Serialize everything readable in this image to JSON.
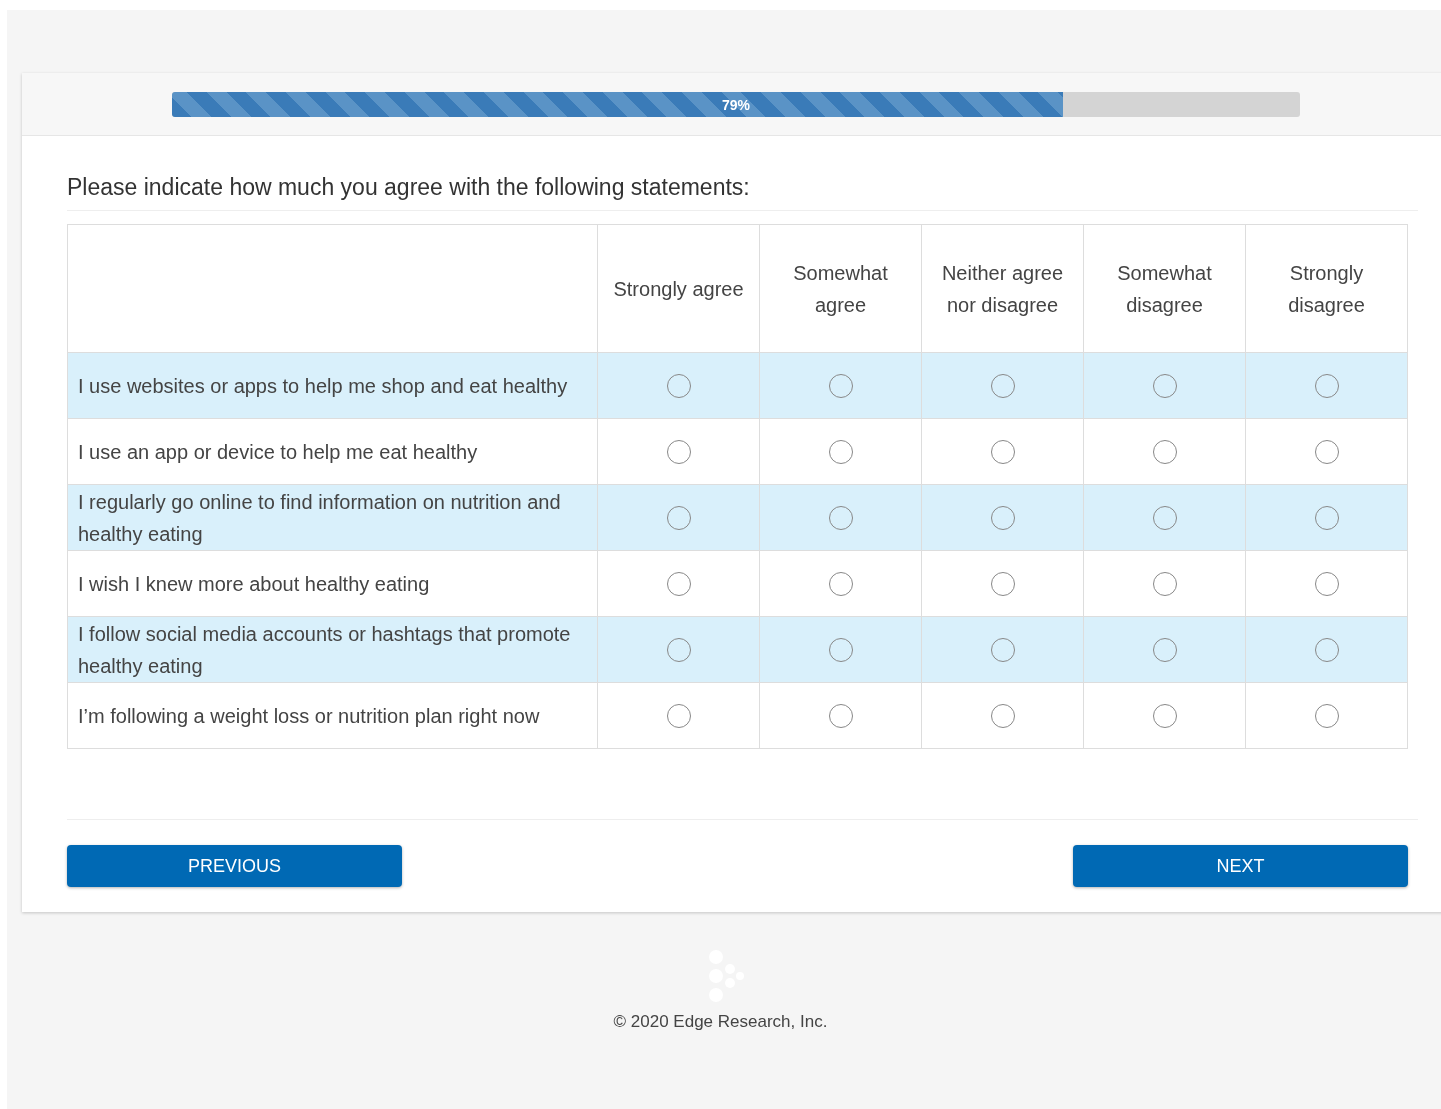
{
  "progress": {
    "level": 0.79,
    "label": "79%"
  },
  "question": "Please indicate how much you agree with the following statements:",
  "columns": [
    "Strongly agree",
    "Somewhat agree",
    "Neither agree nor disagree",
    "Somewhat disagree",
    "Strongly disagree"
  ],
  "rows": [
    {
      "statement": "I use websites or apps to help me shop and eat healthy",
      "options": [
        {
          "selected": false
        },
        {
          "selected": false
        },
        {
          "selected": false
        },
        {
          "selected": false
        },
        {
          "selected": false
        }
      ]
    },
    {
      "statement": "I use an app or device to help me eat healthy",
      "options": [
        {
          "selected": false
        },
        {
          "selected": false
        },
        {
          "selected": false
        },
        {
          "selected": false
        },
        {
          "selected": false
        }
      ]
    },
    {
      "statement": "I regularly go online to find information on nutrition and healthy eating",
      "options": [
        {
          "selected": false
        },
        {
          "selected": false
        },
        {
          "selected": false
        },
        {
          "selected": false
        },
        {
          "selected": false
        }
      ]
    },
    {
      "statement": "I wish I knew more about healthy eating",
      "options": [
        {
          "selected": false
        },
        {
          "selected": false
        },
        {
          "selected": false
        },
        {
          "selected": false
        },
        {
          "selected": false
        }
      ]
    },
    {
      "statement": "I follow social media accounts or hashtags that promote healthy eating",
      "options": [
        {
          "selected": false
        },
        {
          "selected": false
        },
        {
          "selected": false
        },
        {
          "selected": false
        },
        {
          "selected": false
        }
      ]
    },
    {
      "statement": "I’m following a weight loss or nutrition plan right now",
      "options": [
        {
          "selected": false
        },
        {
          "selected": false
        },
        {
          "selected": false
        },
        {
          "selected": false
        },
        {
          "selected": false
        }
      ]
    }
  ],
  "buttons": {
    "previous": "PREVIOUS",
    "next": "NEXT"
  },
  "footer": "© 2020 Edge Research, Inc."
}
